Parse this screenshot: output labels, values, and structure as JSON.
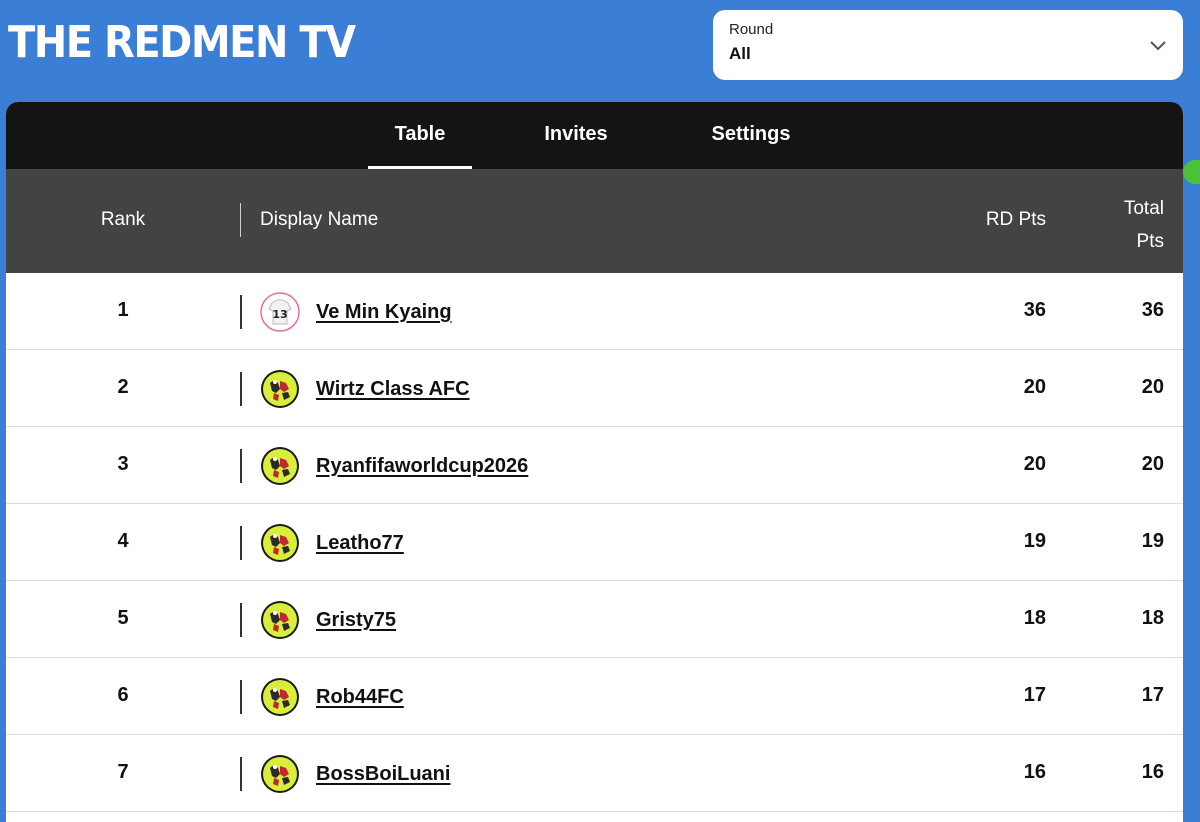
{
  "brand": {
    "title": "THE REDMEN TV"
  },
  "round_select": {
    "label": "Round",
    "value": "All"
  },
  "tabs": [
    {
      "label": "Table",
      "active": true
    },
    {
      "label": "Invites",
      "active": false
    },
    {
      "label": "Settings",
      "active": false
    }
  ],
  "table": {
    "headers": {
      "rank": "Rank",
      "display_name": "Display Name",
      "rd_pts": "RD Pts",
      "total_line1": "Total",
      "total_line2": "Pts"
    },
    "rows": [
      {
        "rank": "1",
        "name": "Ve Min Kyaing",
        "rd_pts": "36",
        "total_pts": "36",
        "avatar": "shirt-13-icon"
      },
      {
        "rank": "2",
        "name": "Wirtz Class AFC",
        "rd_pts": "20",
        "total_pts": "20",
        "avatar": "badge-icon"
      },
      {
        "rank": "3",
        "name": "Ryanfifaworldcup2026",
        "rd_pts": "20",
        "total_pts": "20",
        "avatar": "badge-icon"
      },
      {
        "rank": "4",
        "name": "Leatho77",
        "rd_pts": "19",
        "total_pts": "19",
        "avatar": "badge-icon"
      },
      {
        "rank": "5",
        "name": "Gristy75",
        "rd_pts": "18",
        "total_pts": "18",
        "avatar": "badge-icon"
      },
      {
        "rank": "6",
        "name": "Rob44FC",
        "rd_pts": "17",
        "total_pts": "17",
        "avatar": "badge-icon"
      },
      {
        "rank": "7",
        "name": "BossBoiLuani",
        "rd_pts": "16",
        "total_pts": "16",
        "avatar": "badge-icon"
      }
    ]
  },
  "colors": {
    "background": "#3a7fd5",
    "tab_bar": "#141414",
    "header_row": "#434343",
    "badge_yellow": "#d8ee3a"
  }
}
